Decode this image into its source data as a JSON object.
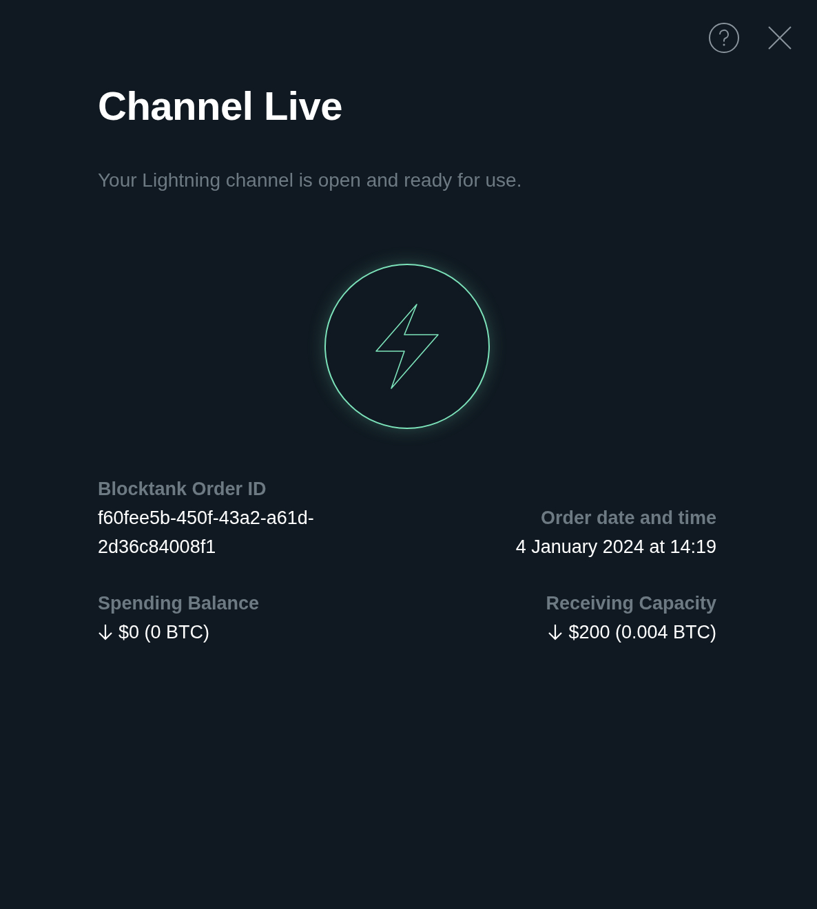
{
  "title": "Channel Live",
  "subtitle": "Your Lightning channel is open and ready for use.",
  "details": [
    {
      "label": "Blocktank Order ID",
      "value": "f60fee5b-450f-43a2-a61d-2d36c84008f1",
      "arrow": false
    },
    {
      "label": "Order date and time",
      "value": "4 January 2024 at 14:19",
      "arrow": false
    },
    {
      "label": "Spending Balance",
      "value": "$0 (0 BTC)",
      "arrow": true
    },
    {
      "label": "Receiving Capacity",
      "value": "$200 (0.004 BTC)",
      "arrow": true
    }
  ]
}
